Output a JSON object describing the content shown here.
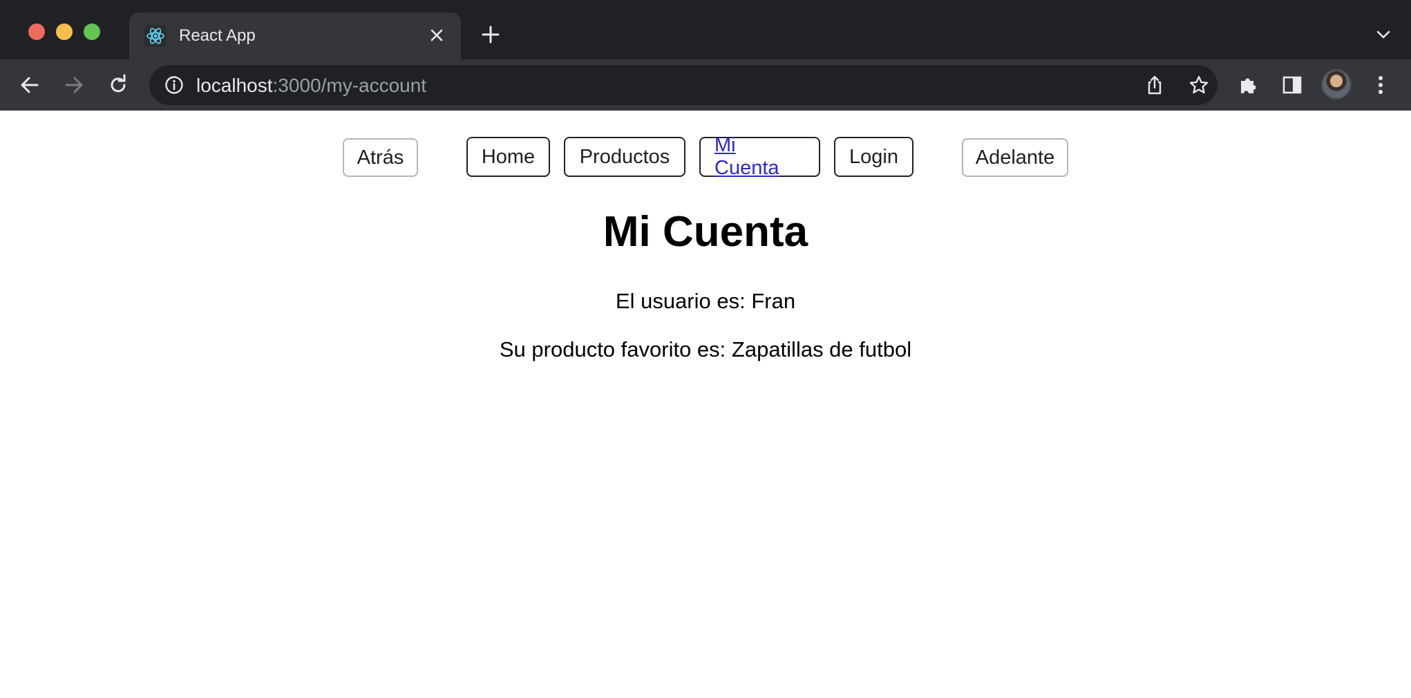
{
  "browser": {
    "tab": {
      "title": "React App",
      "favicon": "react-logo-icon"
    },
    "address_bar": {
      "host": "localhost",
      "path": ":3000/my-account"
    },
    "colors": {
      "tab_strip": "#202124",
      "active_tab": "#35363a",
      "omnibox": "#202124"
    }
  },
  "nav": {
    "back_label": "Atrás",
    "links": [
      {
        "label": "Home"
      },
      {
        "label": "Productos"
      },
      {
        "label": "Mi Cuenta",
        "active": true
      },
      {
        "label": "Login"
      }
    ],
    "forward_label": "Adelante"
  },
  "main": {
    "title": "Mi Cuenta",
    "user_line": "El usuario es: Fran",
    "favorite_line": "Su producto favorito es: Zapatillas de futbol"
  },
  "colors": {
    "active_link": "#2b27c9"
  }
}
